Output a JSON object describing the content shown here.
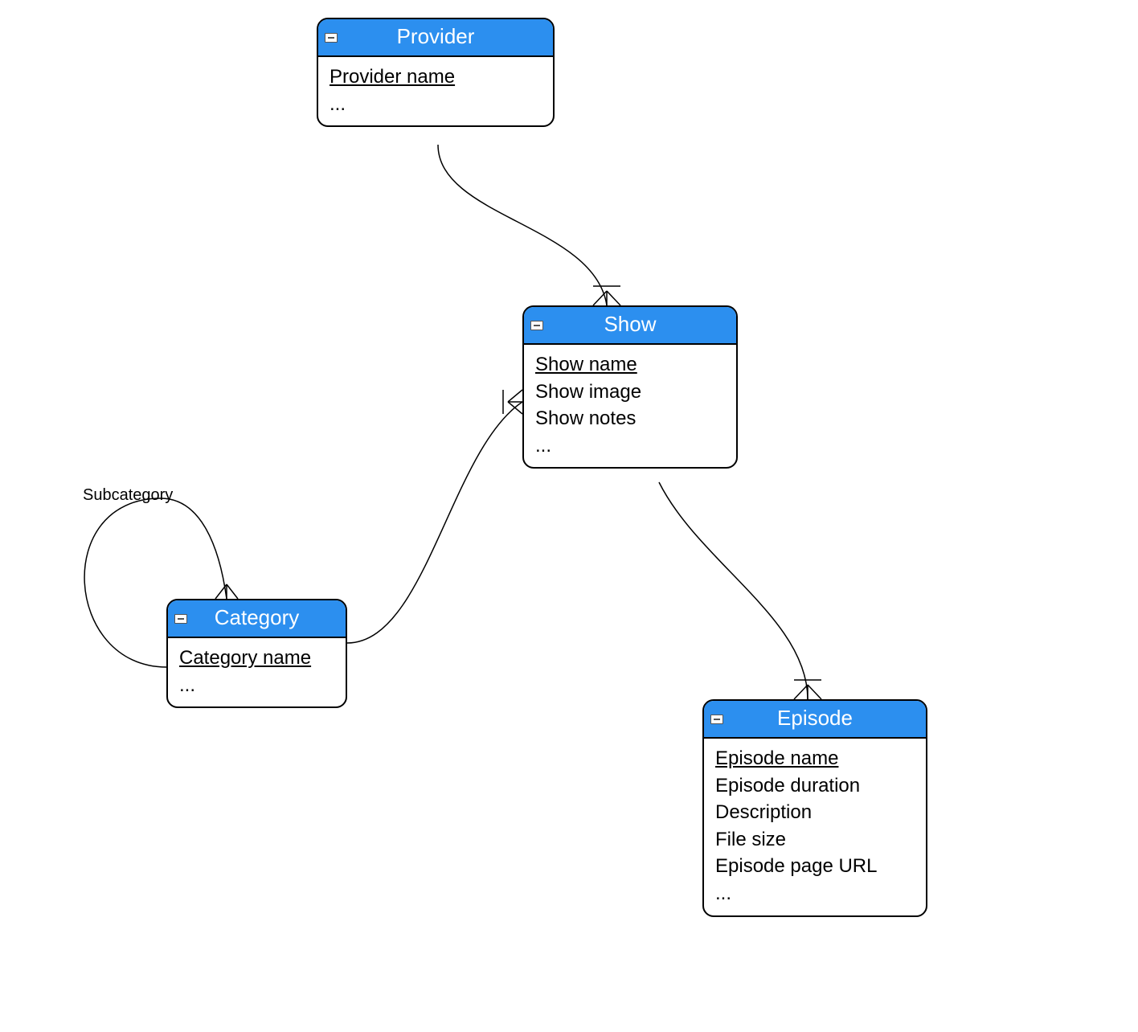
{
  "entities": {
    "provider": {
      "title": "Provider",
      "attrs": {
        "a0": "Provider name",
        "a1": "..."
      },
      "keyIndex": 0
    },
    "show": {
      "title": "Show",
      "attrs": {
        "a0": "Show name",
        "a1": "Show image",
        "a2": "Show notes",
        "a3": "..."
      },
      "keyIndex": 0
    },
    "category": {
      "title": "Category",
      "attrs": {
        "a0": "Category name",
        "a1": "..."
      },
      "keyIndex": 0
    },
    "episode": {
      "title": "Episode",
      "attrs": {
        "a0": "Episode name",
        "a1": "Episode duration",
        "a2": "Description",
        "a3": "File size",
        "a4": "Episode page URL",
        "a5": "..."
      },
      "keyIndex": 0
    }
  },
  "labels": {
    "subcategory": "Subcategory"
  },
  "colors": {
    "header": "#2C8FEF",
    "border": "#000000"
  }
}
